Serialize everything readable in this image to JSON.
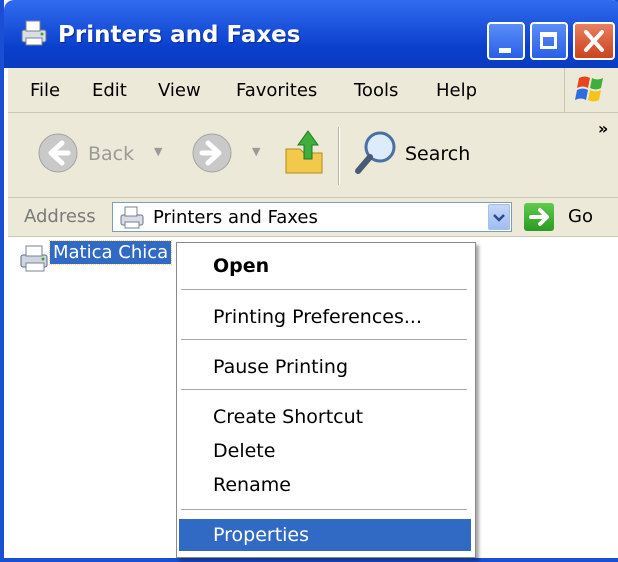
{
  "window": {
    "title": "Printers and Faxes"
  },
  "menubar": {
    "items": [
      "File",
      "Edit",
      "View",
      "Favorites",
      "Tools",
      "Help"
    ]
  },
  "toolbar": {
    "back_label": "Back",
    "search_label": "Search",
    "overflow": "»"
  },
  "address": {
    "label": "Address",
    "value": "Printers and Faxes",
    "go_label": "Go"
  },
  "content": {
    "selected_item": "Matica Chica"
  },
  "context_menu": {
    "items": [
      {
        "label": "Open",
        "bold": true
      },
      {
        "label": "Printing Preferences..."
      },
      {
        "label": "Pause Printing"
      },
      {
        "label": "Create Shortcut"
      },
      {
        "label": "Delete"
      },
      {
        "label": "Rename"
      },
      {
        "label": "Properties",
        "selected": true
      }
    ]
  },
  "icons": {
    "title": "printer-fax-icon",
    "logo": "windows-logo-icon",
    "back": "back-arrow-icon",
    "forward": "forward-arrow-icon",
    "up": "folder-up-icon",
    "search": "magnifier-icon",
    "go": "go-arrow-icon",
    "printer": "printer-icon"
  },
  "colors": {
    "titlebar": "#0a3fcd",
    "selection": "#316ac5",
    "chrome": "#ece9d8"
  }
}
